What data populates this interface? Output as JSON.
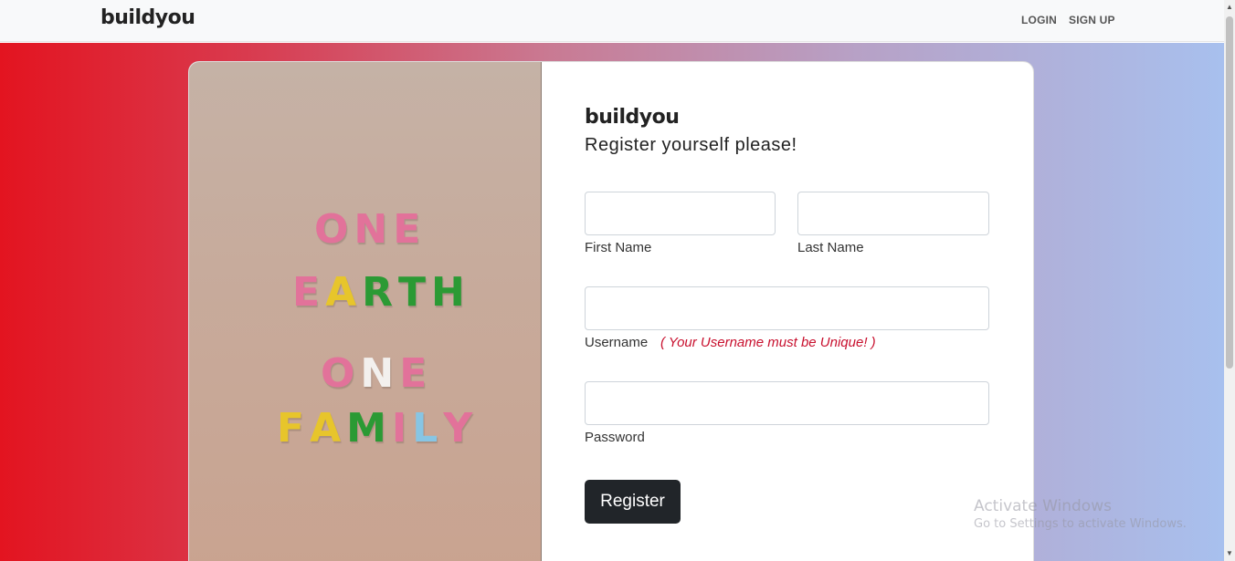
{
  "navbar": {
    "brand": "buildyou",
    "login_label": "LOGIN",
    "signup_label": "SIGN UP"
  },
  "photo": {
    "lines": [
      {
        "text": "ONE",
        "letters": [
          {
            "c": "O",
            "color": "#e2729a"
          },
          {
            "c": "N",
            "color": "#e2729a"
          },
          {
            "c": "E",
            "color": "#e2729a"
          }
        ]
      },
      {
        "text": "EARTH",
        "letters": [
          {
            "c": "E",
            "color": "#e2729a"
          },
          {
            "c": "A",
            "color": "#e7c52b"
          },
          {
            "c": "R",
            "color": "#2b9a34"
          },
          {
            "c": "T",
            "color": "#2b9a34"
          },
          {
            "c": "H",
            "color": "#2b9a34"
          }
        ]
      },
      {
        "text": "ONE",
        "letters": [
          {
            "c": "O",
            "color": "#e2729a"
          },
          {
            "c": "N",
            "color": "#f3f0ee"
          },
          {
            "c": "E",
            "color": "#e2729a"
          }
        ]
      },
      {
        "text": "FAMILY",
        "letters": [
          {
            "c": "F",
            "color": "#e7c52b"
          },
          {
            "c": "A",
            "color": "#e7c52b"
          },
          {
            "c": "M",
            "color": "#2b9a34"
          },
          {
            "c": "I",
            "color": "#e2729a"
          },
          {
            "c": "L",
            "color": "#87c5e4"
          },
          {
            "c": "Y",
            "color": "#e2729a"
          }
        ]
      }
    ]
  },
  "form": {
    "brand": "buildyou",
    "title": "Register yourself please!",
    "first_name_label": "First Name",
    "last_name_label": "Last Name",
    "username_label": "Username",
    "username_hint": "( Your Username must be Unique! )",
    "password_label": "Password",
    "register_label": "Register"
  },
  "watermark": {
    "line1": "Activate Windows",
    "line2": "Go to Settings to activate Windows."
  },
  "colors": {
    "gradient_start": "#e31420",
    "gradient_end": "#a8c0ee",
    "button": "#212529",
    "hint": "#c8102e"
  }
}
